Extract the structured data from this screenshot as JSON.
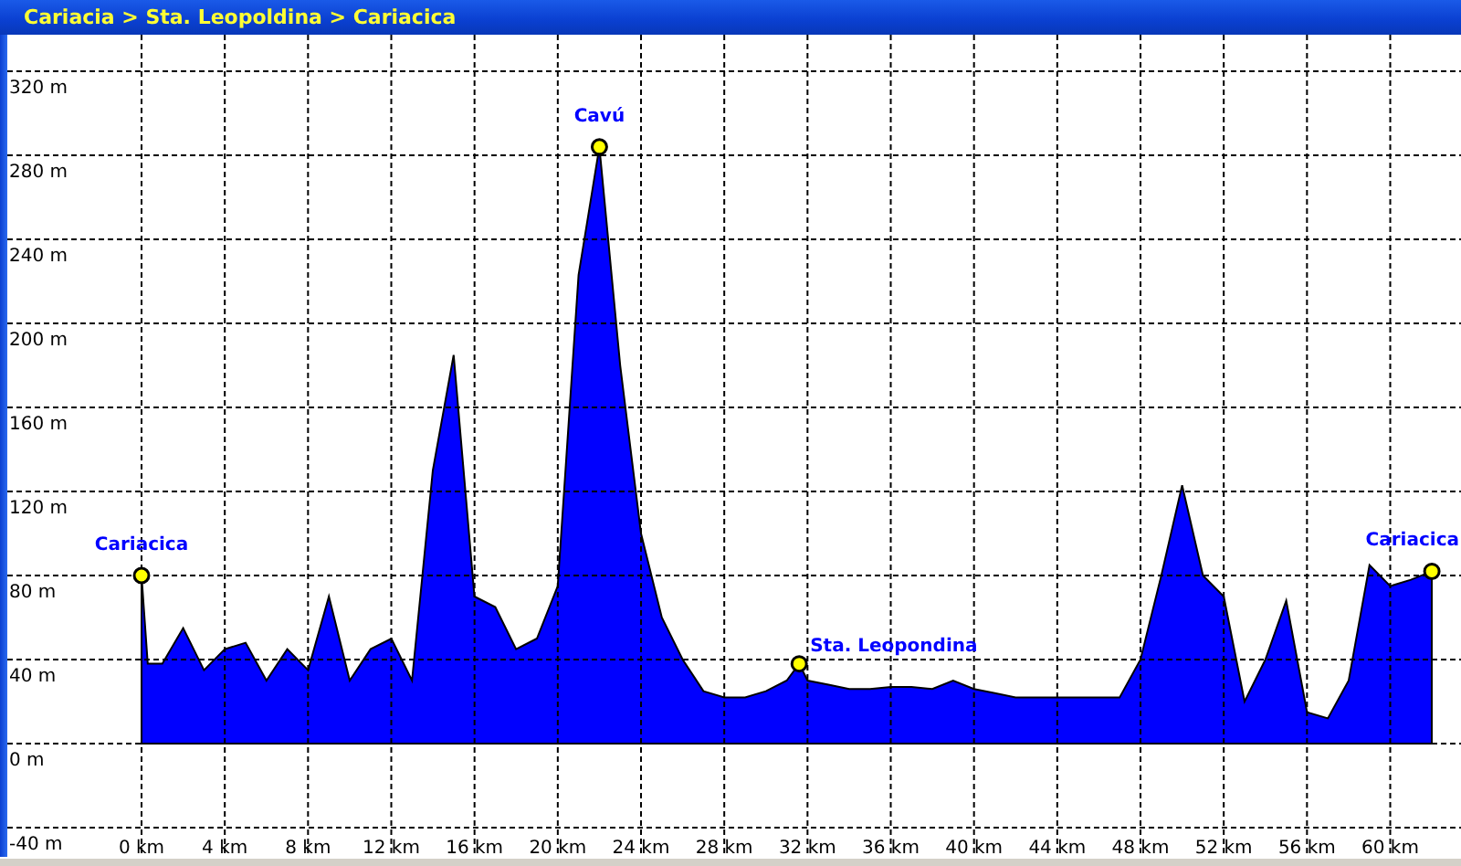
{
  "window": {
    "title": "Cariacia > Sta. Leopoldina > Cariacica"
  },
  "profile": {
    "chart_data": {
      "type": "area",
      "xlim": [
        -6.45,
        63.4
      ],
      "ylim": [
        -53.9,
        337.4
      ],
      "grid": true,
      "x": [
        0,
        0.3,
        1,
        2,
        3,
        4,
        5,
        6,
        7,
        8,
        9,
        10,
        11,
        12,
        13,
        14,
        15,
        16,
        17,
        18,
        19,
        20,
        21,
        22,
        23,
        24,
        25,
        26,
        27,
        28,
        29,
        30,
        31,
        31.6,
        32,
        33,
        34,
        35,
        36,
        37,
        38,
        39,
        40,
        41,
        42,
        43,
        44,
        45,
        46,
        47,
        48,
        49,
        50,
        51,
        52,
        53,
        54,
        55,
        56,
        57,
        58,
        59,
        60,
        61,
        62
      ],
      "series": [
        {
          "color": "#0000ff",
          "values": [
            80,
            38,
            38,
            55,
            35,
            45,
            48,
            30,
            45,
            35,
            70,
            30,
            45,
            50,
            30,
            130,
            185,
            70,
            65,
            45,
            50,
            75,
            223,
            284,
            180,
            100,
            60,
            40,
            25,
            22,
            22,
            25,
            30,
            38,
            30,
            28,
            26,
            26,
            27,
            27,
            26,
            30,
            26,
            24,
            22,
            22,
            22,
            22,
            22,
            22,
            40,
            80,
            123,
            80,
            70,
            20,
            40,
            68,
            15,
            12,
            30,
            85,
            75,
            78,
            82
          ]
        }
      ],
      "xticks": [
        {
          "value": 0,
          "label": "0 km"
        },
        {
          "value": 4,
          "label": "4 km"
        },
        {
          "value": 8,
          "label": "8 km"
        },
        {
          "value": 12,
          "label": "12 km"
        },
        {
          "value": 16,
          "label": "16 km"
        },
        {
          "value": 20,
          "label": "20 km"
        },
        {
          "value": 24,
          "label": "24 km"
        },
        {
          "value": 28,
          "label": "28 km"
        },
        {
          "value": 32,
          "label": "32 km"
        },
        {
          "value": 36,
          "label": "36 km"
        },
        {
          "value": 40,
          "label": "40 km"
        },
        {
          "value": 44,
          "label": "44 km"
        },
        {
          "value": 48,
          "label": "48 km"
        },
        {
          "value": 52,
          "label": "52 km"
        },
        {
          "value": 56,
          "label": "56 km"
        },
        {
          "value": 60,
          "label": "60 km"
        }
      ],
      "yticks": [
        {
          "value": -40,
          "label": "-40 m"
        },
        {
          "value": 0,
          "label": "0 m"
        },
        {
          "value": 40,
          "label": "40 m"
        },
        {
          "value": 80,
          "label": "80 m"
        },
        {
          "value": 120,
          "label": "120 m"
        },
        {
          "value": 160,
          "label": "160 m"
        },
        {
          "value": 200,
          "label": "200 m"
        },
        {
          "value": 240,
          "label": "240 m"
        },
        {
          "value": 280,
          "label": "280 m"
        },
        {
          "value": 320,
          "label": "320 m"
        }
      ],
      "annotations": [
        {
          "x": 0,
          "y": 80,
          "text": "Cariacica"
        },
        {
          "x": 22,
          "y": 284,
          "text": "Cavú"
        },
        {
          "x": 31.6,
          "y": 38,
          "text": "Sta. Leopondina"
        },
        {
          "x": 62,
          "y": 82,
          "text": "Cariacica"
        }
      ]
    }
  }
}
